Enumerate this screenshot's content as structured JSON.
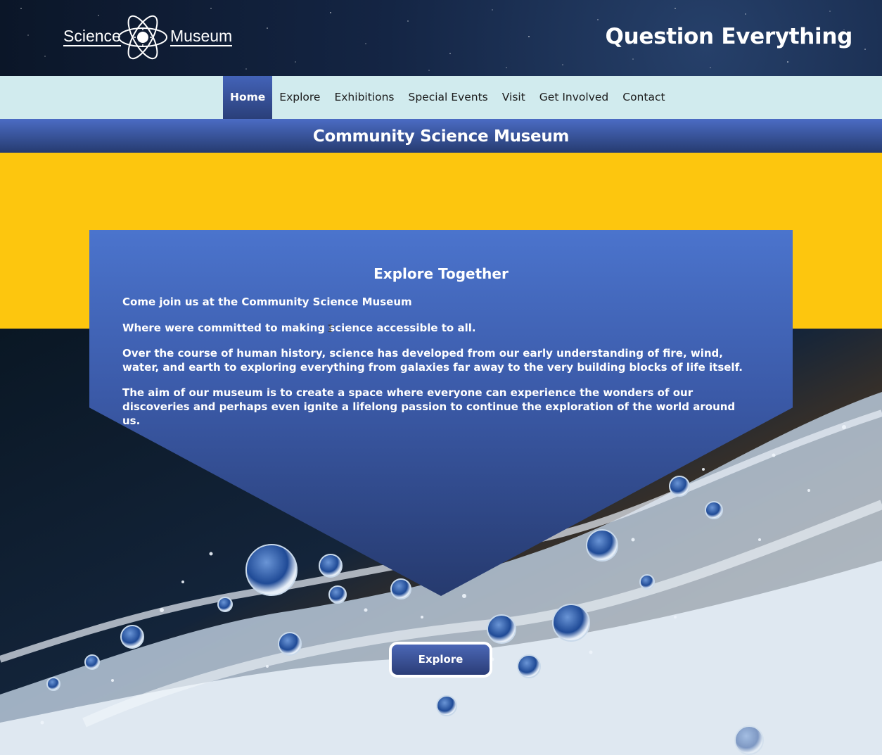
{
  "header": {
    "logo_left": "Science",
    "logo_right": "Museum",
    "tagline": "Question Everything"
  },
  "nav": {
    "items": [
      {
        "label": "Home",
        "active": true
      },
      {
        "label": "Explore",
        "active": false
      },
      {
        "label": "Exhibitions",
        "active": false
      },
      {
        "label": "Special Events",
        "active": false
      },
      {
        "label": "Visit",
        "active": false
      },
      {
        "label": "Get Involved",
        "active": false
      },
      {
        "label": "Contact",
        "active": false
      }
    ]
  },
  "page": {
    "title": "Community Science Museum"
  },
  "card": {
    "heading": "Explore Together",
    "paragraphs": [
      "Come join us at the Community Science Museum",
      "Where were committed to making science accessible to all.",
      "Over the course of human history, science has developed from our early understanding of fire, wind, water, and earth to exploring everything from galaxies far away to the very building blocks of life itself.",
      "The aim of our museum is to create a space where everyone can experience the wonders of our discoveries and perhaps even ignite a lifelong passion to continue the exploration of the world around us."
    ]
  },
  "cta": {
    "label": "Explore"
  },
  "colors": {
    "nav_bg": "#d1ebee",
    "accent_blue": "#3b5aa8",
    "yellow": "#fdc60e"
  }
}
